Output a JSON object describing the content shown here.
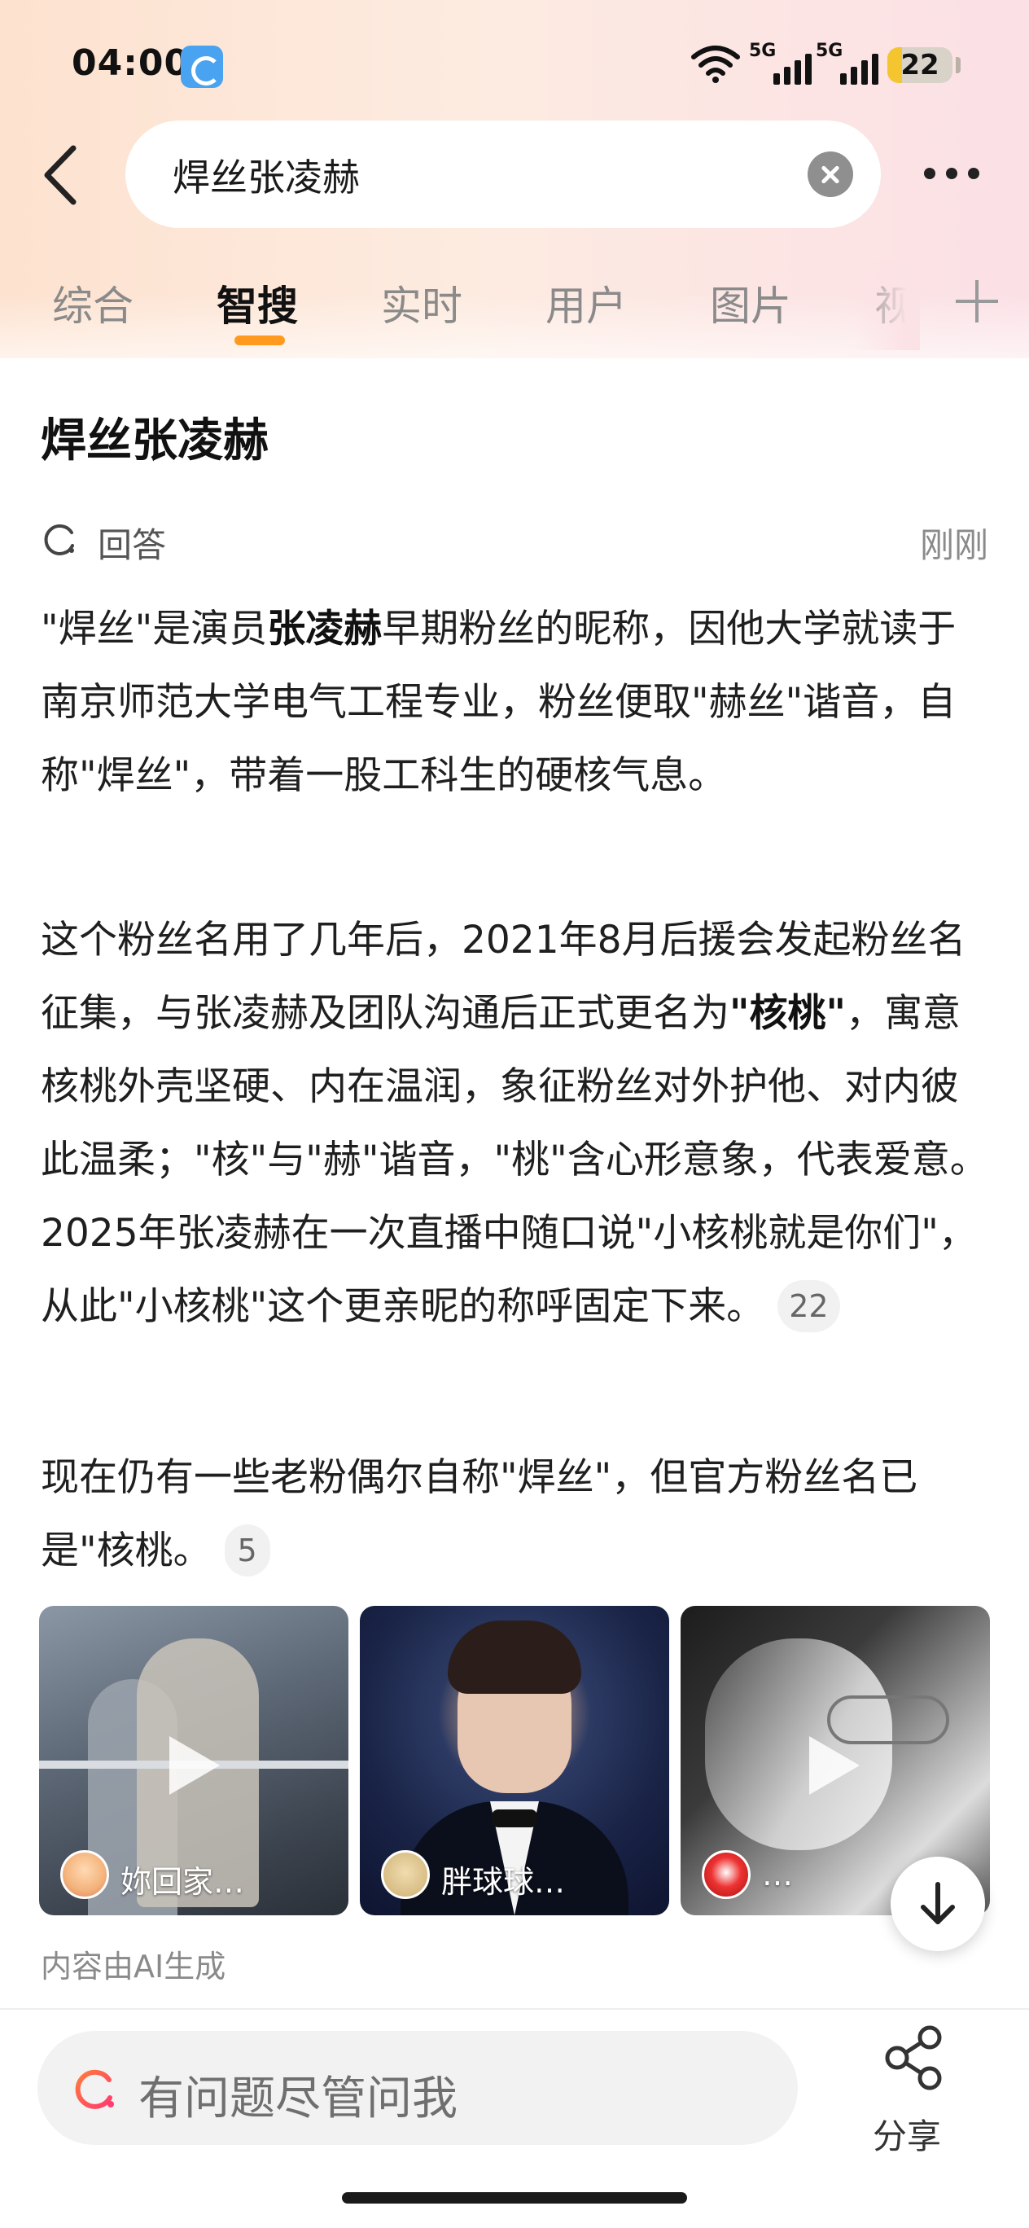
{
  "status_bar": {
    "time": "04:00",
    "signal1_label": "5G",
    "signal2_label": "5G",
    "battery_level": "22",
    "battery_fraction": 0.22
  },
  "header": {
    "search_query": "焊丝张凌赫"
  },
  "tabs": [
    {
      "label": "综合",
      "active": false
    },
    {
      "label": "智搜",
      "active": true
    },
    {
      "label": "实时",
      "active": false
    },
    {
      "label": "用户",
      "active": false
    },
    {
      "label": "图片",
      "active": false
    },
    {
      "label": "视",
      "active": false
    }
  ],
  "content": {
    "title": "焊丝张凌赫",
    "answer_label": "回答",
    "answer_time": "刚刚",
    "para1": {
      "before": "\"焊丝\"是演员",
      "bold": "张凌赫",
      "after": "早期粉丝的昵称，因他大学就读于南京师范大学电气工程专业，粉丝便取\"赫丝\"谐音，自称\"焊丝\"，带着一股工科生的硬核气息。"
    },
    "para2": {
      "before": "这个粉丝名用了几年后，2021年8月后援会发起粉丝名征集，与张凌赫及团队沟通后正式更名为",
      "bold": "\"核桃\"",
      "after": "，寓意核桃外壳坚硬、内在温润，象征粉丝对外护他、对内彼此温柔；\"核\"与\"赫\"谐音，\"桃\"含心形意象，代表爱意。2025年张凌赫在一次直播中随口说\"小核桃就是你们\"，从此\"小核桃\"这个更亲昵的称呼固定下来。",
      "citation": "22"
    },
    "para3": {
      "text": "现在仍有一些老粉偶尔自称\"焊丝\"，但官方粉丝名已是\"核桃。",
      "citation": "5"
    },
    "thumbnails": [
      {
        "author": "妳回家…"
      },
      {
        "author": "胖球球…"
      },
      {
        "author": "…"
      }
    ],
    "ai_note": "内容由AI生成"
  },
  "bottom": {
    "ask_placeholder": "有问题尽管问我",
    "share_label": "分享"
  },
  "colors": {
    "accent": "#ff9a1f",
    "header_bg": "#fde2cf"
  }
}
